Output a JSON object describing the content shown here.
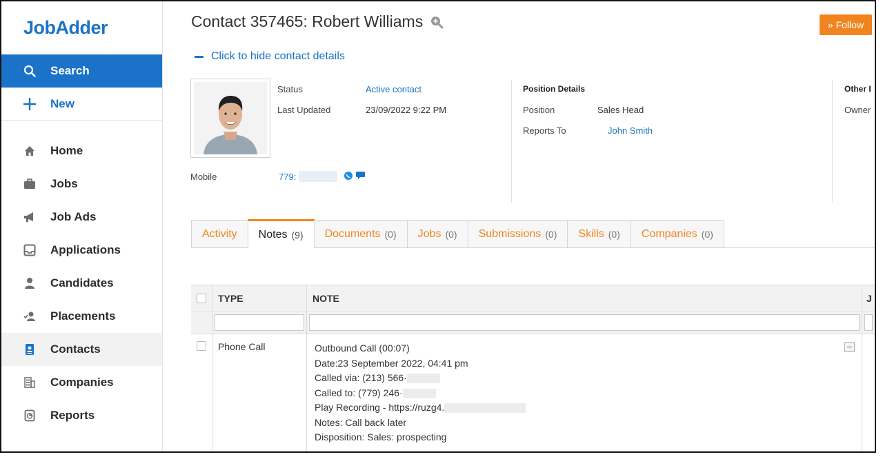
{
  "brand": {
    "logo": "JobAdder"
  },
  "sidebar": {
    "top_items": [
      {
        "label": "Search",
        "icon": "search-icon"
      },
      {
        "label": "New",
        "icon": "plus-icon"
      }
    ],
    "items": [
      {
        "label": "Home",
        "icon": "home-icon"
      },
      {
        "label": "Jobs",
        "icon": "briefcase-icon"
      },
      {
        "label": "Job Ads",
        "icon": "megaphone-icon"
      },
      {
        "label": "Applications",
        "icon": "inbox-icon"
      },
      {
        "label": "Candidates",
        "icon": "person-icon"
      },
      {
        "label": "Placements",
        "icon": "placement-icon"
      },
      {
        "label": "Contacts",
        "icon": "contact-card-icon",
        "active": true
      },
      {
        "label": "Companies",
        "icon": "building-icon"
      },
      {
        "label": "Reports",
        "icon": "report-icon"
      }
    ]
  },
  "header": {
    "title": "Contact 357465: Robert Williams",
    "follow_label": "» Follow",
    "hide_details_label": "Click to hide contact details"
  },
  "contact": {
    "status_label": "Status",
    "status_value": "Active contact",
    "last_updated_label": "Last Updated",
    "last_updated_value": "23/09/2022 9:22 PM",
    "mobile_label": "Mobile",
    "mobile_value": "779:"
  },
  "position": {
    "heading": "Position Details",
    "position_label": "Position",
    "position_value": "Sales Head",
    "reports_to_label": "Reports To",
    "reports_to_value": "John Smith"
  },
  "other": {
    "heading": "Other I",
    "owner_label": "Owner"
  },
  "tabs": [
    {
      "label": "Activity",
      "count": ""
    },
    {
      "label": "Notes",
      "count": "(9)",
      "active": true
    },
    {
      "label": "Documents",
      "count": "(0)"
    },
    {
      "label": "Jobs",
      "count": "(0)"
    },
    {
      "label": "Submissions",
      "count": "(0)"
    },
    {
      "label": "Skills",
      "count": "(0)"
    },
    {
      "label": "Companies",
      "count": "(0)"
    }
  ],
  "table": {
    "columns": [
      "TYPE",
      "NOTE",
      "J"
    ],
    "rows": [
      {
        "type": "Phone Call",
        "note_lines": [
          "Outbound Call (00:07)",
          "Date:23 September 2022, 04:41 pm",
          "Called via: (213) 566·",
          "Called to: (779) 246·",
          "Play Recording - https://ruzg4.",
          "Notes: Call back later",
          "Disposition: Sales: prospecting"
        ]
      }
    ]
  },
  "colors": {
    "accent": "#1a73c8",
    "orange": "#f0851f"
  }
}
